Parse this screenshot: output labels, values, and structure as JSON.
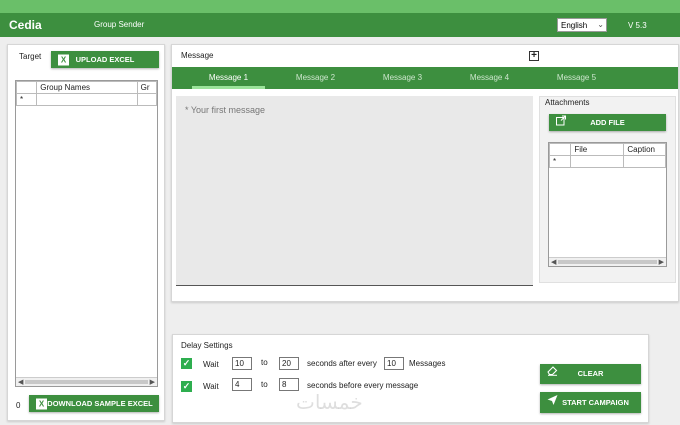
{
  "app": {
    "title": "Cedia",
    "subtitle": "Group Sender",
    "language": "English",
    "version": "V 5.3"
  },
  "target": {
    "label": "Target",
    "upload_label": "UPLOAD EXCEL",
    "columns": [
      "Group Names",
      "Gr"
    ],
    "new_row_marker": "*",
    "count": "0",
    "download_label": "DOWNLOAD SAMPLE EXCEL"
  },
  "message": {
    "label": "Message",
    "add_symbol": "+",
    "tabs": [
      "Message 1",
      "Message 2",
      "Message 3",
      "Message 4",
      "Message 5"
    ],
    "active_tab": 0,
    "placeholder": "* Your first message"
  },
  "attachments": {
    "label": "Attachments",
    "add_label": "ADD FILE",
    "columns": [
      "File",
      "Caption"
    ],
    "new_row_marker": "*"
  },
  "delay": {
    "label": "Delay Settings",
    "row1": {
      "wait": "Wait",
      "from": "10",
      "to_label": "to",
      "to": "20",
      "after": "seconds after every",
      "count": "10",
      "unit": "Messages"
    },
    "row2": {
      "wait": "Wait",
      "from": "4",
      "to_label": "to",
      "to": "8",
      "after": "seconds before every message"
    }
  },
  "actions": {
    "clear_label": "CLEAR",
    "start_label": "START CAMPAIGN"
  },
  "watermark": "خمسات",
  "colors": {
    "primary": "#3d8f3f",
    "topstrip": "#6abf69",
    "check": "#2eae4f"
  }
}
